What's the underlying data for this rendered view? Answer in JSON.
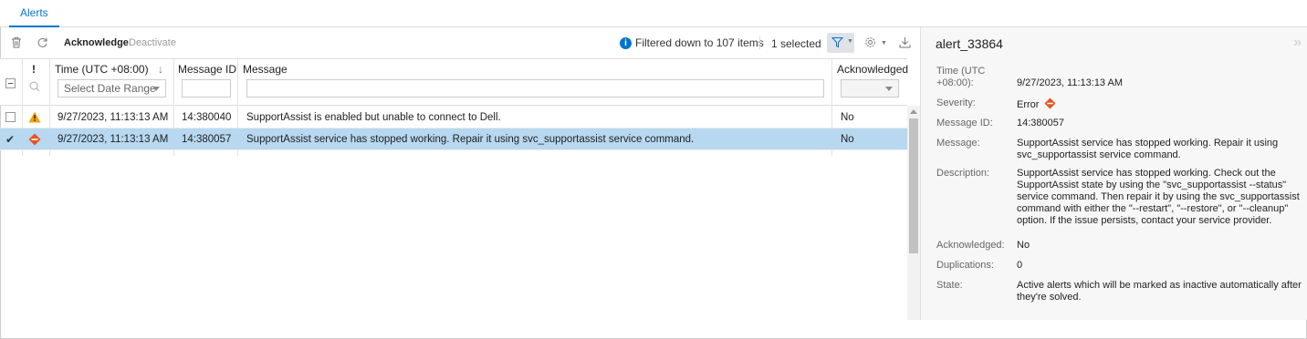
{
  "tabs": [
    {
      "label": "Alerts"
    }
  ],
  "toolbar": {
    "acknowledge_label": "Acknowledge",
    "deactivate_label": "Deactivate",
    "filter_info": "Filtered down to 107 items",
    "selected_count": "1 selected"
  },
  "grid": {
    "columns": {
      "severity": "!",
      "time": "Time (UTC +08:00)",
      "message_id": "Message ID",
      "message": "Message",
      "acknowledged": "Acknowledged"
    },
    "filters": {
      "date_range": "Select Date Range",
      "message_id": "",
      "message": "",
      "acknowledged": ""
    },
    "rows": [
      {
        "severity": "warning",
        "time": "9/27/2023, 11:13:13 AM",
        "message_id": "14:380040",
        "message": "SupportAssist is enabled but unable to connect to Dell.",
        "acknowledged": "No",
        "selected": false
      },
      {
        "severity": "error",
        "time": "9/27/2023, 11:13:13 AM",
        "message_id": "14:380057",
        "message": "SupportAssist service has stopped working. Repair it using svc_supportassist service command.",
        "acknowledged": "No",
        "selected": true
      }
    ]
  },
  "detail": {
    "title": "alert_33864",
    "fields": {
      "time_label": "Time (UTC +08:00):",
      "time_value": "9/27/2023, 11:13:13 AM",
      "severity_label": "Severity:",
      "severity_value": "Error",
      "message_id_label": "Message ID:",
      "message_id_value": "14:380057",
      "message_label": "Message:",
      "message_value": "SupportAssist service has stopped working. Repair it using svc_supportassist service command.",
      "description_label": "Description:",
      "description_value": "SupportAssist service has stopped working. Check out the SupportAssist state by using the \"svc_supportassist --status\" service command. Then repair it by using the svc_supportassist command with either the \"--restart\", \"--restore\", or \"--cleanup\" option. If the issue persists, contact your service provider.",
      "acknowledged_label": "Acknowledged:",
      "acknowledged_value": "No",
      "duplications_label": "Duplications:",
      "duplications_value": "0",
      "state_label": "State:",
      "state_value": "Active alerts which will be marked as inactive automatically after they're solved."
    }
  },
  "colors": {
    "accent": "#0076ce",
    "selected_row": "#b7d8f0",
    "warning": "#f0a30a",
    "error": "#e8531f"
  },
  "icons": [
    "trash-icon",
    "refresh-icon",
    "info-icon",
    "filter-icon",
    "gear-icon",
    "download-icon",
    "warning-icon",
    "error-icon",
    "collapse-icon",
    "search-filter-icon"
  ]
}
